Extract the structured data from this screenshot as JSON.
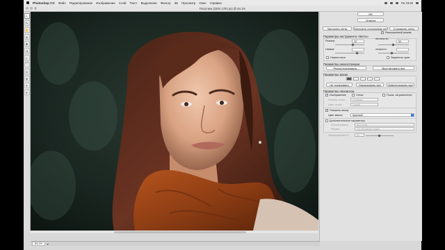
{
  "menubar": {
    "app": "Photoshop CC",
    "items": [
      "Файл",
      "Редактирование",
      "Изображение",
      "Слой",
      "Текст",
      "Выделение",
      "Фильтр",
      "3D",
      "Просмотр",
      "Окно",
      "Справка"
    ],
    "clock": "Пн 23:25"
  },
  "window": {
    "title": "Пластика (2304 1782 px) @ 64.1%"
  },
  "tools": [
    "↖",
    "✎",
    "✋",
    "◎",
    "✸",
    "⇲",
    "◐",
    "⌒",
    "⊙",
    "⊗",
    "✦",
    "⌖",
    "☺",
    "⊕",
    "⊡",
    "⊠"
  ],
  "panel": {
    "ok": "OK",
    "cancel": "Отмена",
    "load_mesh": "Загрузить сетку",
    "load_last": "Загрузить последнюю сетку",
    "save_mesh": "Сохранить сетку",
    "advanced": "Расширенный режим",
    "brush_section": "Параметры инструмента «Кисть»",
    "brush_size_label": "Размер:",
    "brush_size": "10",
    "density_label": "плотность:",
    "density": "50",
    "pressure_label": "Нажим:",
    "pressure": "",
    "rate_label": "скорость:",
    "rate": "",
    "stylus": "Нажим пера",
    "pin_edges": "Закрепить края",
    "reconstruct_section": "Параметры реконструкции",
    "reconstruct_btn": "Реконструировать...",
    "restore_all": "Восстановить все",
    "mask_section": "Параметры маски",
    "none_btn": "Не показывать",
    "mask_all": "Маскировать все",
    "invert_all": "Инвертировать все",
    "view_section": "Параметры просмотра",
    "show_image": "Изображение",
    "show_mesh": "Сетка",
    "show_layers": "Показ. заграничение",
    "mesh_size_label": "Размер сетки:",
    "mesh_size": "Средняя",
    "mesh_color_label": "Цвет сетки:",
    "mesh_color": "Серый",
    "show_mask": "Показать маску",
    "mask_color_label": "Цвет маски:",
    "mask_color": "Красный",
    "backdrop_section": "Дополнительные параметры",
    "use_label": "Использовать:",
    "use_value": "Все слои",
    "mode_label": "Режим:",
    "mode_value": "На переднем плане",
    "opacity_label": "Непрозрачность:",
    "opacity_value": "50"
  },
  "status": {
    "zoom": "64,1%"
  }
}
